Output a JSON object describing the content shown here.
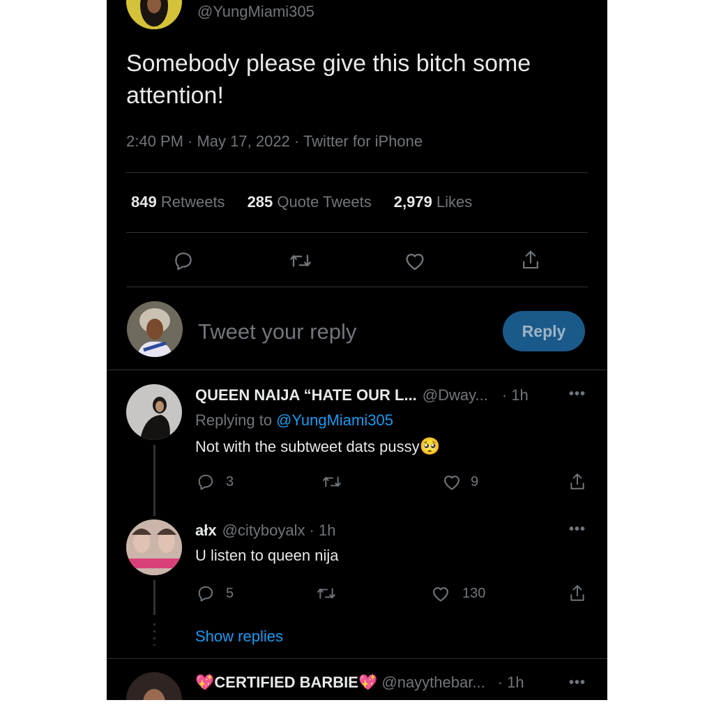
{
  "tweet": {
    "handle": "@YungMiami305",
    "text": "Somebody please give this bitch some attention!",
    "meta": "2:40 PM · May 17, 2022 · Twitter for iPhone",
    "stats": {
      "retweets_count": "849",
      "retweets_label": "Retweets",
      "quotes_count": "285",
      "quotes_label": "Quote Tweets",
      "likes_count": "2,979",
      "likes_label": "Likes"
    }
  },
  "composer": {
    "placeholder": "Tweet your reply",
    "reply_button": "Reply"
  },
  "replies": [
    {
      "name": "QUEEN NAIJA “HATE OUR L...",
      "handle": "@Dway...",
      "time": "· 1h",
      "replying_prefix": "Replying to",
      "replying_to": "@YungMiami305",
      "text": "Not with the subtweet dats pussy",
      "emoji": "🥺",
      "replies": "3",
      "likes": "9"
    },
    {
      "name": "ałx",
      "handle": "@cityboyalx",
      "time": "· 1h",
      "text": "U listen to queen nija",
      "replies": "5",
      "likes": "130"
    },
    {
      "name": "CERTIFIED BARBIE",
      "emoji_left": "💖",
      "emoji_right": "💖",
      "handle": "@nayythebar...",
      "time": "· 1h"
    }
  ],
  "show_replies": "Show replies",
  "more_icon_glyph": "•••",
  "colors": {
    "background": "#000000",
    "text": "#e7e9ea",
    "muted": "#71767b",
    "link": "#1d9bf0",
    "reply_button": "#1a5a8a",
    "divider": "#2f3336"
  }
}
